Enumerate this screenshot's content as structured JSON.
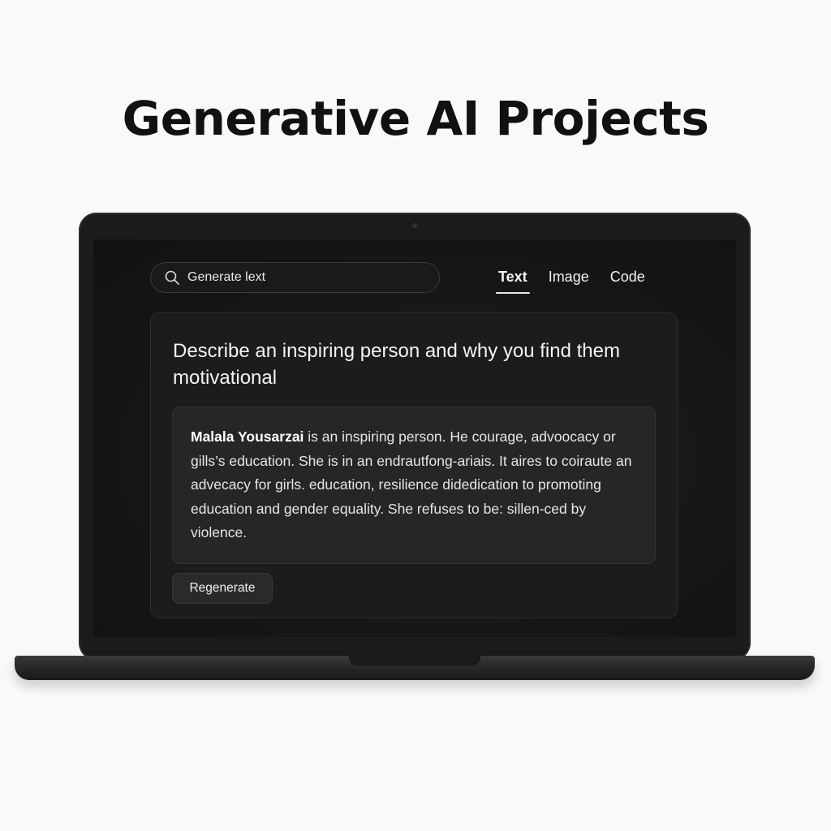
{
  "headline": "Generative AI Projects",
  "search": {
    "placeholder": "Generate lext"
  },
  "tabs": [
    {
      "label": "Text",
      "active": true
    },
    {
      "label": "Image",
      "active": false
    },
    {
      "label": "Code",
      "active": false
    }
  ],
  "card": {
    "prompt": "Describe an inspiring person and why you find them motivational",
    "response": {
      "name": "Malala Yousarzai",
      "body": " is an inspiring person. He courage, advoocacy or gills’s education. She is in an endrautfong-ariais. It aires to coiraute an advecacy for girls. education, resilience didedication to promoting education and gender equality. She refuses to be: sillen-ced by violence."
    },
    "regenerate_label": "Regenerate"
  },
  "icons": {
    "search": "search-icon"
  },
  "colors": {
    "page_background": "#faf9f7",
    "screen_background": "#161617",
    "text_primary": "#f4f4f4"
  }
}
